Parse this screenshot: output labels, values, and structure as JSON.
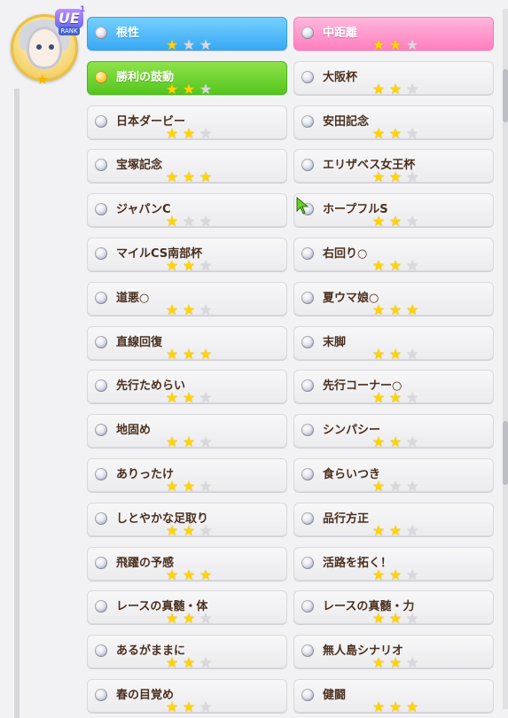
{
  "badge": {
    "ue": "UE",
    "sup": "1",
    "rank": "RANK"
  },
  "skills_left": [
    {
      "name": "根性",
      "stars": 1,
      "style": "blue"
    },
    {
      "name": "勝利の鼓動",
      "stars": 2,
      "style": "green",
      "gold_dot": true
    },
    {
      "name": "日本ダービー",
      "stars": 2
    },
    {
      "name": "宝塚記念",
      "stars": 3
    },
    {
      "name": "ジャパンC",
      "stars": 1
    },
    {
      "name": "マイルCS南部杯",
      "stars": 2
    },
    {
      "name": "道悪○",
      "stars": 2
    },
    {
      "name": "直線回復",
      "stars": 3
    },
    {
      "name": "先行ためらい",
      "stars": 2
    },
    {
      "name": "地固め",
      "stars": 2
    },
    {
      "name": "ありったけ",
      "stars": 2
    },
    {
      "name": "しとやかな足取り",
      "stars": 2
    },
    {
      "name": "飛躍の予感",
      "stars": 3
    },
    {
      "name": "レースの真髄・体",
      "stars": 2
    },
    {
      "name": "あるがままに",
      "stars": 2
    },
    {
      "name": "春の目覚め",
      "stars": 2
    }
  ],
  "skills_right": [
    {
      "name": "中距離",
      "stars": 2,
      "style": "pink"
    },
    {
      "name": "大阪杯",
      "stars": 2
    },
    {
      "name": "安田記念",
      "stars": 2
    },
    {
      "name": "エリザベス女王杯",
      "stars": 2
    },
    {
      "name": "ホープフルS",
      "stars": 2
    },
    {
      "name": "右回り○",
      "stars": 2
    },
    {
      "name": "夏ウマ娘○",
      "stars": 3
    },
    {
      "name": "末脚",
      "stars": 2
    },
    {
      "name": "先行コーナー○",
      "stars": 2
    },
    {
      "name": "シンパシー",
      "stars": 2
    },
    {
      "name": "食らいつき",
      "stars": 1
    },
    {
      "name": "品行方正",
      "stars": 2
    },
    {
      "name": "活路を拓く！",
      "stars": 2
    },
    {
      "name": "レースの真髄・力",
      "stars": 2
    },
    {
      "name": "無人島シナリオ",
      "stars": 2
    },
    {
      "name": "健闘",
      "stars": 3
    }
  ]
}
